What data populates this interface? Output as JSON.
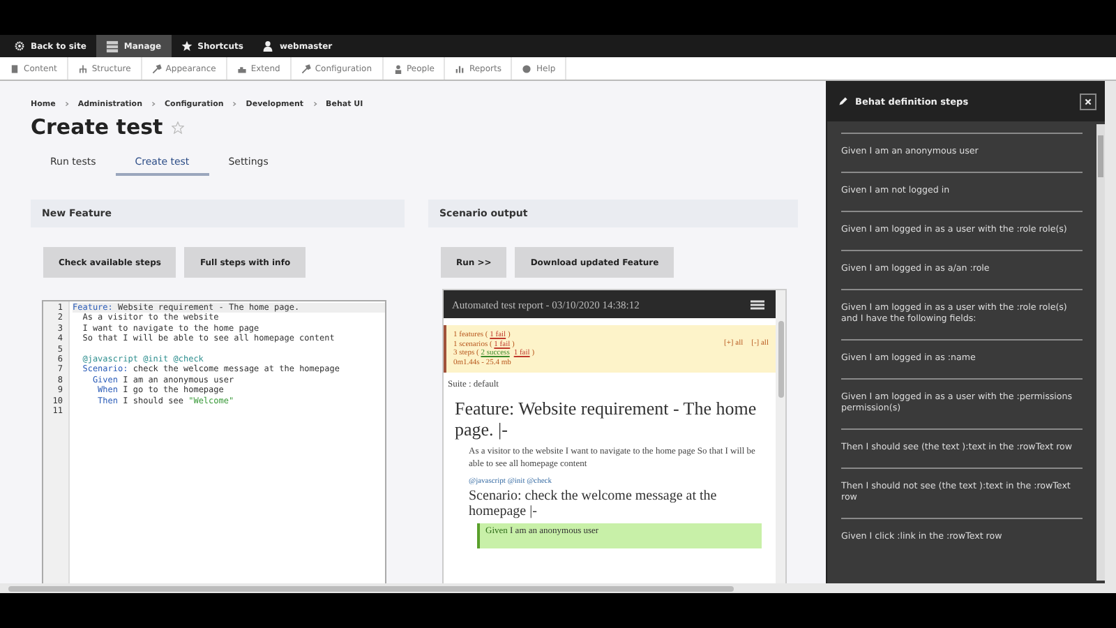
{
  "toolbar": {
    "items": [
      {
        "label": "Back to site",
        "selected": false
      },
      {
        "label": "Manage",
        "selected": true
      },
      {
        "label": "Shortcuts",
        "selected": false
      },
      {
        "label": "webmaster",
        "selected": false
      }
    ]
  },
  "admin_menu": {
    "items": [
      "Content",
      "Structure",
      "Appearance",
      "Extend",
      "Configuration",
      "People",
      "Reports",
      "Help"
    ]
  },
  "breadcrumb": [
    "Home",
    "Administration",
    "Configuration",
    "Development",
    "Behat UI"
  ],
  "page_title": "Create test",
  "starred": false,
  "tabs": [
    {
      "label": "Run tests",
      "selected": false
    },
    {
      "label": "Create test",
      "selected": true
    },
    {
      "label": "Settings",
      "selected": false
    }
  ],
  "feature_panel": {
    "title": "New Feature",
    "buttons": [
      "Check available steps",
      "Full steps with info"
    ],
    "editor": {
      "lines": [
        {
          "number": "1",
          "segments": [
            {
              "kind": "keyword",
              "text": "Feature:"
            },
            {
              "kind": "plain",
              "text": " Website requirement - The home page."
            }
          ]
        },
        {
          "number": "2",
          "segments": [
            {
              "kind": "plain",
              "text": "  As a visitor to the website"
            }
          ]
        },
        {
          "number": "3",
          "segments": [
            {
              "kind": "plain",
              "text": "  I want to navigate to the home page"
            }
          ]
        },
        {
          "number": "4",
          "segments": [
            {
              "kind": "plain",
              "text": "  So that I will be able to see all homepage content"
            }
          ]
        },
        {
          "number": "5"
        },
        {
          "number": "6",
          "segments": [
            {
              "kind": "tag",
              "text": "  @javascript @init @check"
            }
          ]
        },
        {
          "number": "7",
          "segments": [
            {
              "kind": "keyword",
              "text": "  Scenario:"
            },
            {
              "kind": "plain",
              "text": " check the welcome message at the homepage"
            }
          ]
        },
        {
          "number": "8",
          "segments": [
            {
              "kind": "keyword",
              "text": "    Given"
            },
            {
              "kind": "plain",
              "text": " I am an anonymous user"
            }
          ]
        },
        {
          "number": "9",
          "segments": [
            {
              "kind": "keyword",
              "text": "     When"
            },
            {
              "kind": "plain",
              "text": " I go to the homepage"
            }
          ]
        },
        {
          "number": "10",
          "segments": [
            {
              "kind": "keyword",
              "text": "     Then"
            },
            {
              "kind": "plain",
              "text": " I should see "
            },
            {
              "kind": "string",
              "text": "\"Welcome\""
            }
          ]
        },
        {
          "number": "11"
        }
      ]
    }
  },
  "output_panel": {
    "title": "Scenario output",
    "buttons": [
      "Run >>",
      "Download updated Feature"
    ],
    "report": {
      "header": "Automated test report - 03/10/2020 14:38:12",
      "summary": [
        [
          {
            "kind": "plain",
            "text": "1 features ( "
          },
          {
            "kind": "fail",
            "text": "1 fail"
          },
          {
            "kind": "plain",
            "text": " )"
          }
        ],
        [
          {
            "kind": "plain",
            "text": "1 scenarios ( "
          },
          {
            "kind": "fail",
            "text": "1 fail"
          },
          {
            "kind": "plain",
            "text": " )"
          }
        ],
        [
          {
            "kind": "plain",
            "text": "3 steps ( "
          },
          {
            "kind": "success",
            "text": "2 success"
          },
          {
            "kind": "fail",
            "text": "1 fail"
          },
          {
            "kind": "plain",
            "text": " )"
          }
        ],
        [
          {
            "kind": "plain",
            "text": "0m1.44s - 25.4 mb"
          }
        ]
      ],
      "links": [
        "[+] all",
        "[-] all"
      ],
      "suite": "Suite : default",
      "feature": "Feature: Website requirement - The home page. |-",
      "description": "As a visitor to the website I want to navigate to the home page So that I will be able to see all homepage content",
      "tags": "@javascript @init @check",
      "scenario": "Scenario: check the welcome message at the homepage |-",
      "step": {
        "keyword": "Given",
        "text": "I am an anonymous user",
        "passed": true
      }
    }
  },
  "sidebar": {
    "title": "Behat definition steps",
    "steps": [
      "Given I am an anonymous user",
      "Given I am not logged in",
      "Given I am logged in as a user with the :role role(s)",
      "Given I am logged in as a/an :role",
      "Given I am logged in as a user with the :role role(s) and I have the following fields:",
      "Given I am logged in as :name",
      "Given I am logged in as a user with the :permissions permission(s)",
      "Then I should see (the text ):text in the :rowText row",
      "Then I should not see (the text ):text in the :rowText row",
      "Given I click :link in the :rowText row"
    ]
  }
}
